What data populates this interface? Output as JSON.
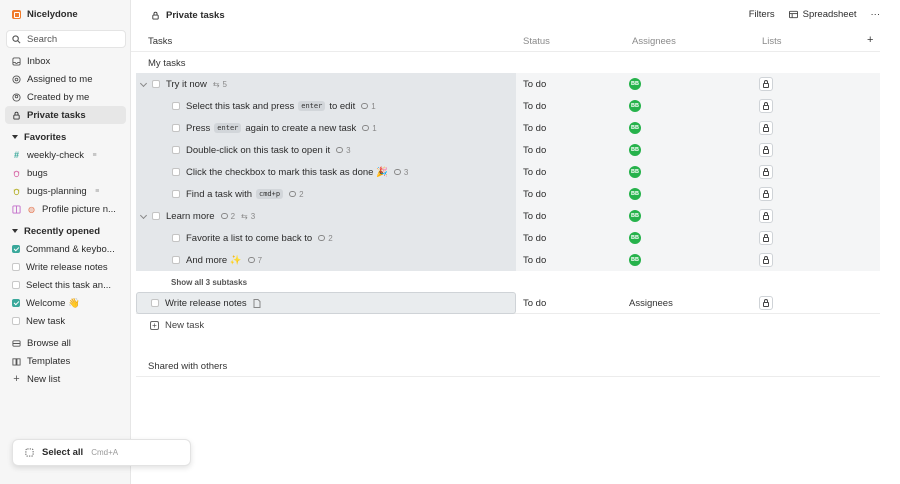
{
  "brand": {
    "name": "Nicelydone"
  },
  "sidebar": {
    "search_label": "Search",
    "nav": [
      {
        "label": "Inbox",
        "icon": "inbox-icon"
      },
      {
        "label": "Assigned to me",
        "icon": "target-icon"
      },
      {
        "label": "Created by me",
        "icon": "user-icon"
      },
      {
        "label": "Private tasks",
        "icon": "lock-icon",
        "active": true
      }
    ],
    "favorites_label": "Favorites",
    "favorites": [
      {
        "label": "weekly-check",
        "icon": "hash-icon"
      },
      {
        "label": "bugs",
        "icon": "bug-icon"
      },
      {
        "label": "bugs-planning",
        "icon": "bug-icon"
      },
      {
        "label": "Profile picture n...",
        "icon": "grid-icon"
      }
    ],
    "recent_label": "Recently opened",
    "recent": [
      {
        "label": "Command & keybo...",
        "checked": true
      },
      {
        "label": "Write release notes",
        "checked": false
      },
      {
        "label": "Select this task an...",
        "checked": false
      },
      {
        "label": "Welcome 👋",
        "checked": true
      },
      {
        "label": "New task",
        "checked": false
      }
    ],
    "footer": [
      {
        "label": "Browse all",
        "icon": "stack-icon"
      },
      {
        "label": "Templates",
        "icon": "book-icon"
      },
      {
        "label": "New list",
        "icon": "plus-icon"
      }
    ]
  },
  "toast": {
    "label": "Select all",
    "shortcut": "Cmd+A"
  },
  "header": {
    "title": "Private tasks",
    "filters": "Filters",
    "view": "Spreadsheet",
    "more": "···"
  },
  "columns": {
    "tasks": "Tasks",
    "status": "Status",
    "assignees": "Assignees",
    "lists": "Lists",
    "add": "+"
  },
  "groups": {
    "my_tasks": "My tasks",
    "shared": "Shared with others"
  },
  "rows": [
    {
      "title": "Try it now",
      "subtasks": "5",
      "status": "To do",
      "assignee": "BB"
    },
    {
      "title_a": "Select this task and press",
      "kbd": "enter",
      "title_b": "to edit",
      "comments": "1",
      "status": "To do",
      "assignee": "BB"
    },
    {
      "title_a": "Press",
      "kbd": "enter",
      "title_b": "again to create a new task",
      "comments": "1",
      "status": "To do",
      "assignee": "BB"
    },
    {
      "title": "Double-click on this task to open it",
      "comments": "3",
      "status": "To do",
      "assignee": "BB"
    },
    {
      "title": "Click the checkbox to mark this task as done 🎉",
      "comments": "3",
      "status": "To do",
      "assignee": "BB"
    },
    {
      "title_a": "Find a task with",
      "kbd": "cmd+p",
      "comments": "2",
      "status": "To do",
      "assignee": "BB"
    },
    {
      "title": "Learn more",
      "comments": "2",
      "subtasks": "3",
      "status": "To do",
      "assignee": "BB"
    },
    {
      "title": "Favorite a list to come back to",
      "comments": "2",
      "status": "To do",
      "assignee": "BB"
    },
    {
      "title": "And more ✨",
      "comments": "7",
      "status": "To do",
      "assignee": "BB"
    }
  ],
  "show_all": "Show all 3 subtasks",
  "standalone": {
    "title": "Write release notes",
    "status": "To do",
    "assignees": "Assignees"
  },
  "new_task": "New task"
}
